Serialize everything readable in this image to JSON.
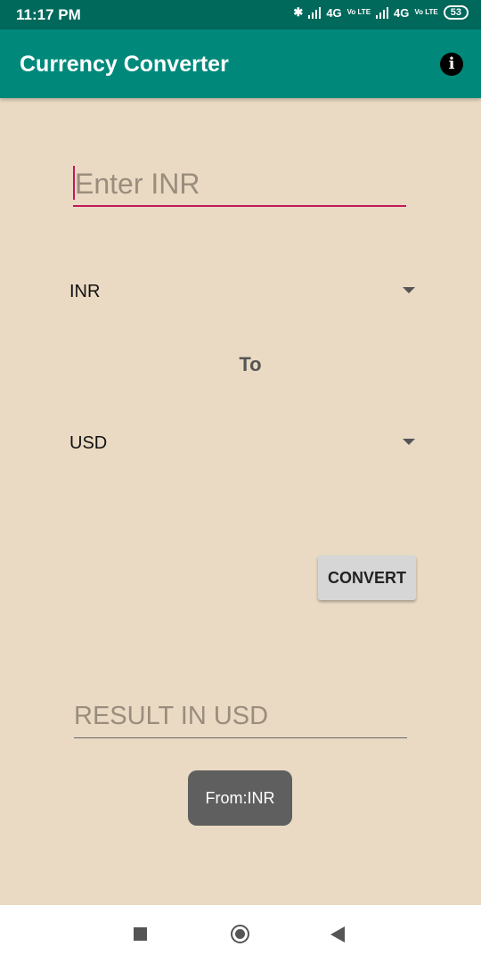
{
  "status_bar": {
    "time": "11:17 PM",
    "network1": "4G",
    "network2": "4G",
    "volte": "Vo LTE",
    "battery": "53"
  },
  "app_bar": {
    "title": "Currency Converter",
    "info_icon": "info-icon"
  },
  "form": {
    "amount_placeholder": "Enter INR",
    "from_currency": "INR",
    "to_label": "To",
    "to_currency": "USD",
    "convert_label": "CONVERT",
    "result_placeholder": "RESULT IN USD"
  },
  "toast": {
    "text": "From:INR"
  },
  "colors": {
    "status_bar": "#00695c",
    "app_bar": "#00897b",
    "background": "#eadac3",
    "accent": "#c2185b"
  }
}
